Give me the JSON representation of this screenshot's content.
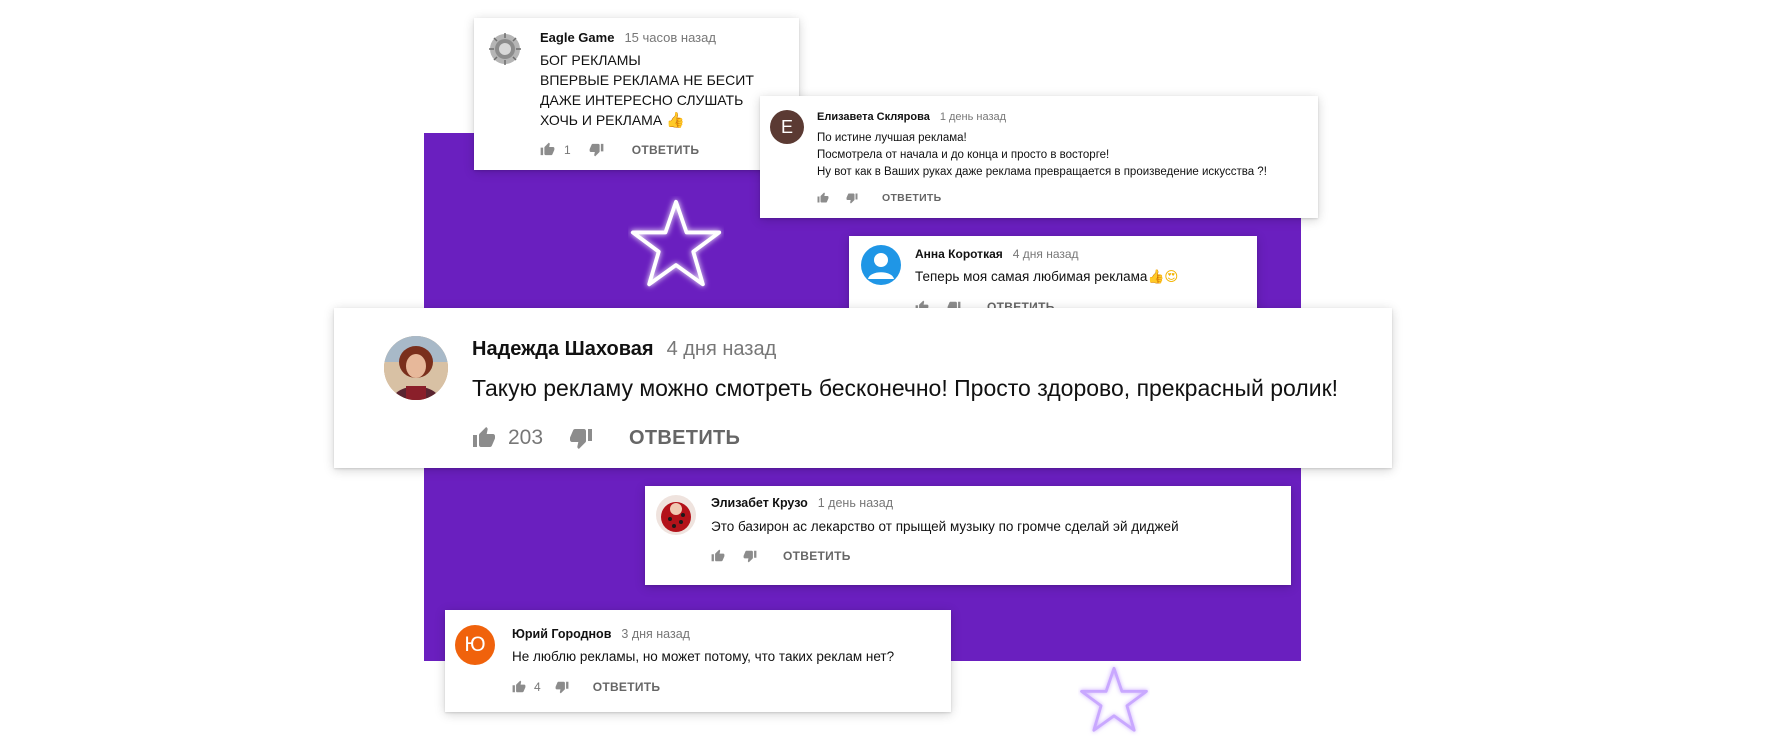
{
  "colors": {
    "panel": "#6a1fbf",
    "star_glow": "#e9d7ff",
    "avatar_elizaveta": "#5b3a33",
    "avatar_anna": "#1f96e6",
    "avatar_yuri": "#f0620c"
  },
  "reply_label": "ОТВЕТИТЬ",
  "comments": {
    "eagle": {
      "author": "Eagle Game",
      "time": "15 часов назад",
      "lines": [
        "БОГ РЕКЛАМЫ",
        "ВПЕРВЫЕ РЕКЛАМА НЕ БЕСИТ",
        "ДАЖЕ ИНТЕРЕСНО СЛУШАТЬ",
        "ХОЧЬ И РЕКЛАМА"
      ],
      "likes": "1"
    },
    "elizaveta": {
      "author": "Елизавета Склярова",
      "time": "1 день назад",
      "avatar_letter": "Е",
      "lines": [
        "По истине лучшая реклама!",
        "Посмотрела от начала и до конца и просто в восторге!",
        "Ну вот как в Ваших руках даже реклама превращается в произведение искусства ?!"
      ]
    },
    "anna": {
      "author": "Анна Короткая",
      "time": "4 дня назад",
      "text": "Теперь моя самая любимая реклама"
    },
    "nadezhda": {
      "author": "Надежда Шаховая",
      "time": "4 дня назад",
      "text": "Такую рекламу можно смотреть бесконечно! Просто здорово, прекрасный ролик!",
      "likes": "203"
    },
    "elizabet": {
      "author": "Элизабет Крузо",
      "time": "1 день назад",
      "text": "Это базирон ас лекарство от прыщей музыку по громче сделай эй диджей"
    },
    "yuri": {
      "author": "Юрий Городнов",
      "time": "3 дня назад",
      "avatar_letter": "Ю",
      "text": "Не люблю рекламы, но может потому, что таких реклам нет?",
      "likes": "4"
    }
  }
}
